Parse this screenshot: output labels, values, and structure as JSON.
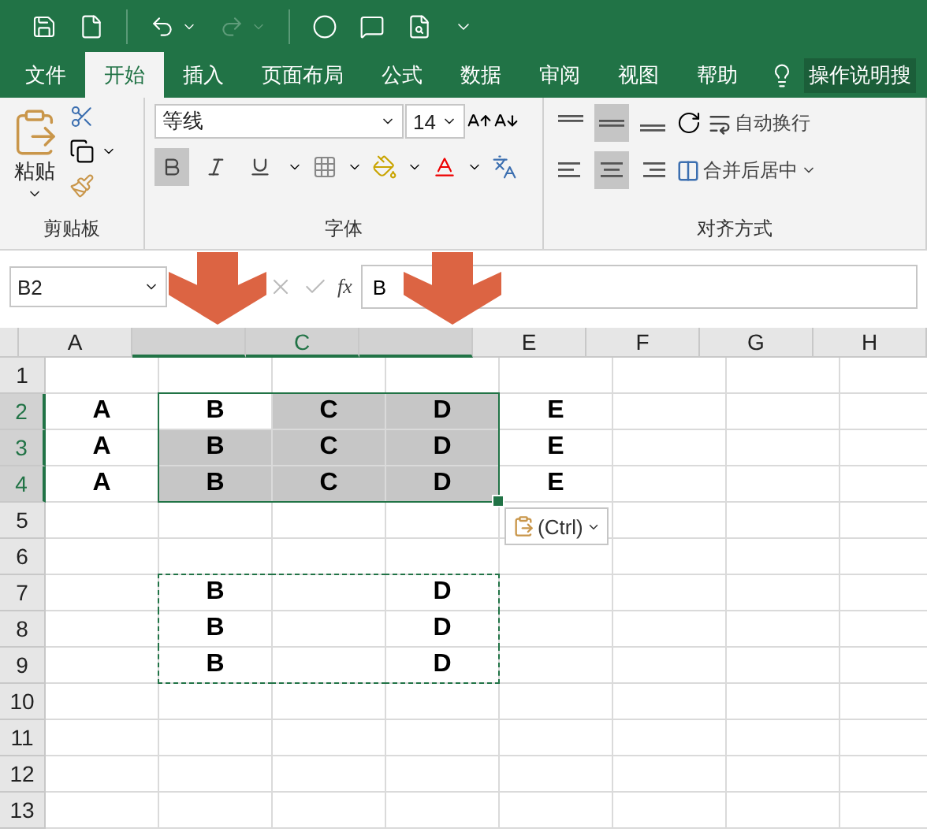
{
  "tabs": [
    {
      "label": "文件",
      "selected": false
    },
    {
      "label": "开始",
      "selected": true
    },
    {
      "label": "插入",
      "selected": false
    },
    {
      "label": "页面布局",
      "selected": false
    },
    {
      "label": "公式",
      "selected": false
    },
    {
      "label": "数据",
      "selected": false
    },
    {
      "label": "审阅",
      "selected": false
    },
    {
      "label": "视图",
      "selected": false
    },
    {
      "label": "帮助",
      "selected": false
    }
  ],
  "tell_me": "操作说明搜",
  "ribbon": {
    "clipboard": {
      "paste": "粘贴",
      "label": "剪贴板"
    },
    "font": {
      "name": "等线",
      "size": "14",
      "bold": true,
      "italic": false,
      "underline": false,
      "label": "字体"
    },
    "alignment": {
      "vertical": [
        {
          "selected": false
        },
        {
          "selected": true
        },
        {
          "selected": false
        }
      ],
      "horizontal": [
        {
          "selected": false
        },
        {
          "selected": true
        },
        {
          "selected": false
        }
      ],
      "wrap": "自动换行",
      "merge": "合并后居中",
      "label": "对齐方式"
    }
  },
  "formula_bar": {
    "name_box": "B2",
    "function_label": "fx",
    "value": "B"
  },
  "grid": {
    "columns": [
      {
        "label": "A",
        "selected": false
      },
      {
        "selected": true
      },
      {
        "label": "C",
        "selected": true
      },
      {
        "selected": true
      },
      {
        "label": "E",
        "selected": false
      },
      {
        "label": "F",
        "selected": false
      },
      {
        "label": "G",
        "selected": false
      },
      {
        "label": "H",
        "selected": false
      }
    ],
    "rows": [
      {
        "label": "1",
        "selected": false
      },
      {
        "label": "2",
        "selected": true,
        "cells": [
          {
            "text": "A"
          },
          {
            "text": "B",
            "selected": true,
            "active": true
          },
          {
            "text": "C",
            "selected": true
          },
          {
            "text": "D",
            "selected": true
          },
          {
            "text": "E"
          }
        ]
      },
      {
        "label": "3",
        "selected": true,
        "cells": [
          {
            "text": "A"
          },
          {
            "text": "B",
            "selected": true
          },
          {
            "text": "C",
            "selected": true
          },
          {
            "text": "D",
            "selected": true
          },
          {
            "text": "E"
          }
        ]
      },
      {
        "label": "4",
        "selected": true,
        "cells": [
          {
            "text": "A"
          },
          {
            "text": "B",
            "selected": true
          },
          {
            "text": "C",
            "selected": true
          },
          {
            "text": "D",
            "selected": true
          },
          {
            "text": "E"
          }
        ]
      },
      {
        "label": "5",
        "selected": false
      },
      {
        "label": "6",
        "selected": false
      },
      {
        "label": "7",
        "selected": false,
        "cells": [
          {},
          {
            "text": "B",
            "copied": true
          },
          {},
          {
            "text": "D",
            "copied": true
          }
        ]
      },
      {
        "label": "8",
        "selected": false,
        "cells": [
          {},
          {
            "text": "B",
            "copied": true
          },
          {},
          {
            "text": "D",
            "copied": true
          }
        ]
      },
      {
        "label": "9",
        "selected": false,
        "cells": [
          {},
          {
            "text": "B",
            "copied": true
          },
          {},
          {
            "text": "D",
            "copied": true
          }
        ]
      },
      {
        "label": "10",
        "selected": false
      },
      {
        "label": "11",
        "selected": false
      },
      {
        "label": "12",
        "selected": false
      },
      {
        "label": "13",
        "selected": false
      }
    ]
  },
  "paste_options": "(Ctrl)"
}
